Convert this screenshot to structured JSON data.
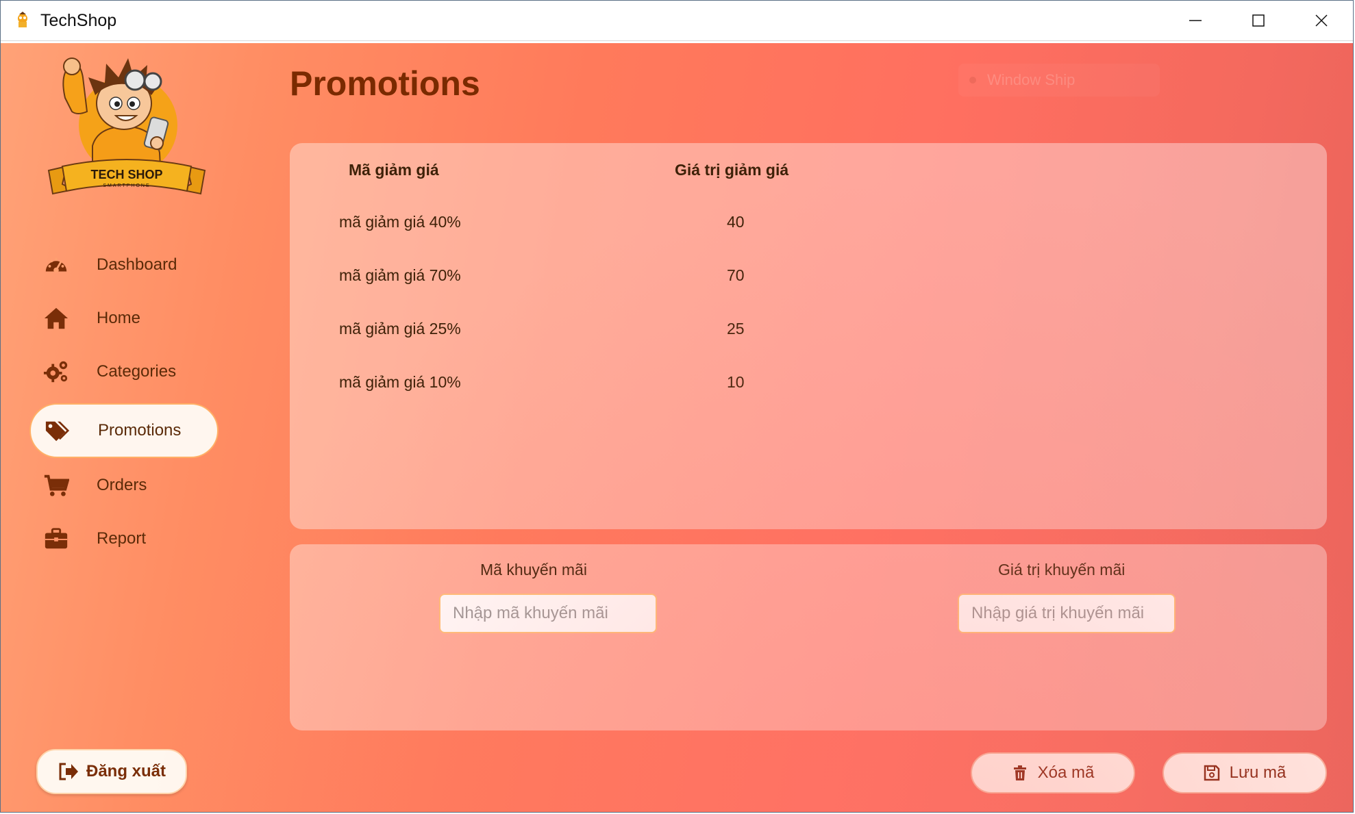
{
  "window": {
    "title": "TechShop",
    "controls": [
      "minimize-icon",
      "maximize-icon",
      "close-icon"
    ]
  },
  "logo": {
    "text": "TECH SHOP",
    "subtext": "SMARTPHONE"
  },
  "sidebar": {
    "items": [
      {
        "label": "Dashboard",
        "icon": "dashboard-gauge-icon",
        "active": false
      },
      {
        "label": "Home",
        "icon": "home-icon",
        "active": false
      },
      {
        "label": "Categories",
        "icon": "gears-icon",
        "active": false
      },
      {
        "label": "Promotions",
        "icon": "tags-icon",
        "active": true
      },
      {
        "label": "Orders",
        "icon": "cart-icon",
        "active": false
      },
      {
        "label": "Report",
        "icon": "briefcase-icon",
        "active": false
      }
    ],
    "logout_label": "Đăng xuất"
  },
  "page": {
    "title": "Promotions",
    "watermark": "Window Ship"
  },
  "table": {
    "columns": [
      "Mã giảm giá",
      "Giá trị giảm giá"
    ],
    "rows": [
      [
        "mã giảm giá 40%",
        "40"
      ],
      [
        "mã giảm giá 70%",
        "70"
      ],
      [
        "mã giảm giá 25%",
        "25"
      ],
      [
        "mã giảm giá 10%",
        "10"
      ]
    ]
  },
  "form": {
    "code_label": "Mã khuyến mãi",
    "code_placeholder": "Nhập mã khuyến mãi",
    "code_value": "",
    "value_label": "Giá trị khuyến mãi",
    "value_placeholder": "Nhập giá trị khuyến mãi",
    "value_value": ""
  },
  "actions": {
    "delete_label": "Xóa mã",
    "save_label": "Lưu mã"
  },
  "colors": {
    "accent_text": "#7a2a00",
    "gradient_start": "#ffa277",
    "gradient_end": "#e8625a",
    "input_border": "#ffc27a"
  }
}
